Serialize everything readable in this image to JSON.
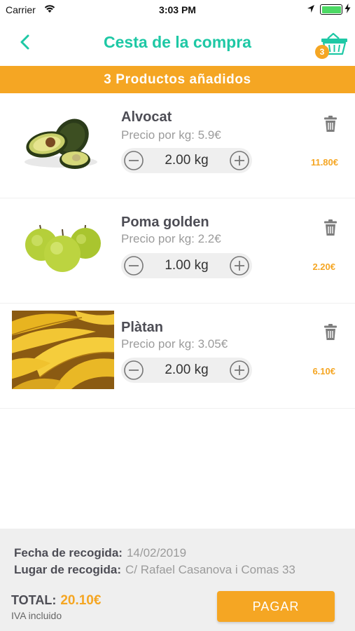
{
  "status_bar": {
    "carrier": "Carrier",
    "time": "3:03 PM",
    "icons": [
      "wifi-icon",
      "location-icon",
      "battery-icon",
      "charging-icon"
    ]
  },
  "nav": {
    "title": "Cesta de la compra",
    "back_icon": "chevron-left-icon",
    "cart_icon": "basket-icon",
    "cart_count": "3"
  },
  "banner": {
    "text": "3 Productos añadidos"
  },
  "products": [
    {
      "name": "Alvocat",
      "unit_price": "Precio por kg: 5.9€",
      "quantity": "2.00 kg",
      "line_total": "11.80€",
      "image": "avocado-image"
    },
    {
      "name": "Poma golden",
      "unit_price": "Precio por kg: 2.2€",
      "quantity": "1.00 kg",
      "line_total": "2.20€",
      "image": "green-apples-image"
    },
    {
      "name": "Plàtan",
      "unit_price": "Precio por kg: 3.05€",
      "quantity": "2.00 kg",
      "line_total": "6.10€",
      "image": "bananas-image"
    }
  ],
  "footer": {
    "pickup_date_label": "Fecha de recogida:",
    "pickup_date_value": "14/02/2019",
    "pickup_place_label": "Lugar de recogida:",
    "pickup_place_value": "C/ Rafael Casanova i Comas 33",
    "total_label": "TOTAL:",
    "total_value": "20.10€",
    "vat_note": "IVA incluido",
    "pay_label": "PAGAR"
  },
  "colors": {
    "accent_teal": "#1ec8a5",
    "accent_orange": "#f5a623",
    "footer_bg": "#efefef"
  }
}
